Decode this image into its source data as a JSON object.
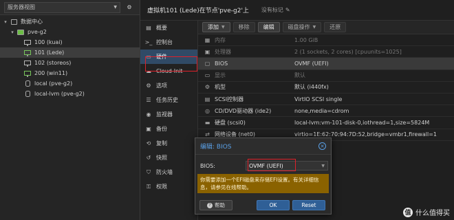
{
  "tree": {
    "view_label": "服务器视图",
    "datacenter": "数据中心",
    "node": "pve-g2",
    "items": [
      {
        "label": "100 (kuai)",
        "kind": "vm",
        "running": false
      },
      {
        "label": "101 (Lede)",
        "kind": "vm",
        "running": true,
        "selected": true
      },
      {
        "label": "102 (storeos)",
        "kind": "vm",
        "running": false
      },
      {
        "label": "200 (win11)",
        "kind": "vm",
        "running": true
      },
      {
        "label": "local (pve-g2)",
        "kind": "storage",
        "running": false
      },
      {
        "label": "local-lvm (pve-g2)",
        "kind": "storage",
        "running": false
      }
    ]
  },
  "main": {
    "title": "虚拟机101 (Lede)在节点'pve-g2'上",
    "tag_placeholder": "没有标记"
  },
  "submenu": [
    {
      "label": "概要",
      "icon": "book-icon",
      "glyph": "▤"
    },
    {
      "label": "控制台",
      "icon": "terminal-icon",
      "glyph": ">_"
    },
    {
      "label": "硬件",
      "icon": "monitor-icon",
      "glyph": "▭",
      "active": true
    },
    {
      "label": "Cloud-Init",
      "icon": "cloud-icon",
      "glyph": "☁"
    },
    {
      "label": "选项",
      "icon": "gear-icon",
      "glyph": "⚙"
    },
    {
      "label": "任务历史",
      "icon": "list-icon",
      "glyph": "☰"
    },
    {
      "label": "监视器",
      "icon": "eye-icon",
      "glyph": "◉"
    },
    {
      "label": "备份",
      "icon": "floppy-icon",
      "glyph": "▣"
    },
    {
      "label": "复制",
      "icon": "retweet-icon",
      "glyph": "⟲"
    },
    {
      "label": "快照",
      "icon": "history-icon",
      "glyph": "↺"
    },
    {
      "label": "防火墙",
      "icon": "shield-icon",
      "glyph": "⛉"
    },
    {
      "label": "权限",
      "icon": "unlock-icon",
      "glyph": "⚿"
    }
  ],
  "toolbar": {
    "add": "添加",
    "remove": "移除",
    "edit": "编辑",
    "disk_action": "磁盘操作",
    "revert": "还原"
  },
  "hardware": [
    {
      "icon": "memory-icon",
      "glyph": "▦",
      "key": "内存",
      "value": "1.00 GiB",
      "dim": true
    },
    {
      "icon": "cpu-icon",
      "glyph": "▣",
      "key": "处理器",
      "value": "2 (1 sockets, 2 cores) [cpuunits=1025]",
      "dim": true
    },
    {
      "icon": "microchip-icon",
      "glyph": "▢",
      "key": "BIOS",
      "value": "OVMF (UEFI)",
      "selected": true
    },
    {
      "icon": "desktop-icon",
      "glyph": "▭",
      "key": "显示",
      "value": "默认",
      "dim": true
    },
    {
      "icon": "cogs-icon",
      "glyph": "⚙",
      "key": "机型",
      "value": "默认 (i440fx)"
    },
    {
      "icon": "database-icon",
      "glyph": "▤",
      "key": "SCSI控制器",
      "value": "VirtIO SCSI single"
    },
    {
      "icon": "cdrom-icon",
      "glyph": "◎",
      "key": "CD/DVD驱动器 (ide2)",
      "value": "none,media=cdrom"
    },
    {
      "icon": "hdd-icon",
      "glyph": "▬",
      "key": "硬盘 (scsi0)",
      "value": "local-lvm:vm-101-disk-0,iothread=1,size=5824M"
    },
    {
      "icon": "exchange-icon",
      "glyph": "⇄",
      "key": "网络设备 (net0)",
      "value": "virtio=1E:62:70:94:7D:52,bridge=vmbr1,firewall=1"
    }
  ],
  "dialog": {
    "title": "编辑: BIOS",
    "field_label": "BIOS:",
    "field_value": "OVMF (UEFI)",
    "warning": "你需要添加一个EFI磁盘来存储EFI设置。有关详细信息，请参见在线帮助。",
    "help": "帮助",
    "ok": "OK",
    "reset": "Reset"
  },
  "watermark": {
    "logo": "值",
    "text": "什么值得买"
  },
  "colors": {
    "accent": "#5aa0e6",
    "selection": "#304a66",
    "warning_bg": "#8a6200",
    "highlight_box": "#e0202a"
  }
}
